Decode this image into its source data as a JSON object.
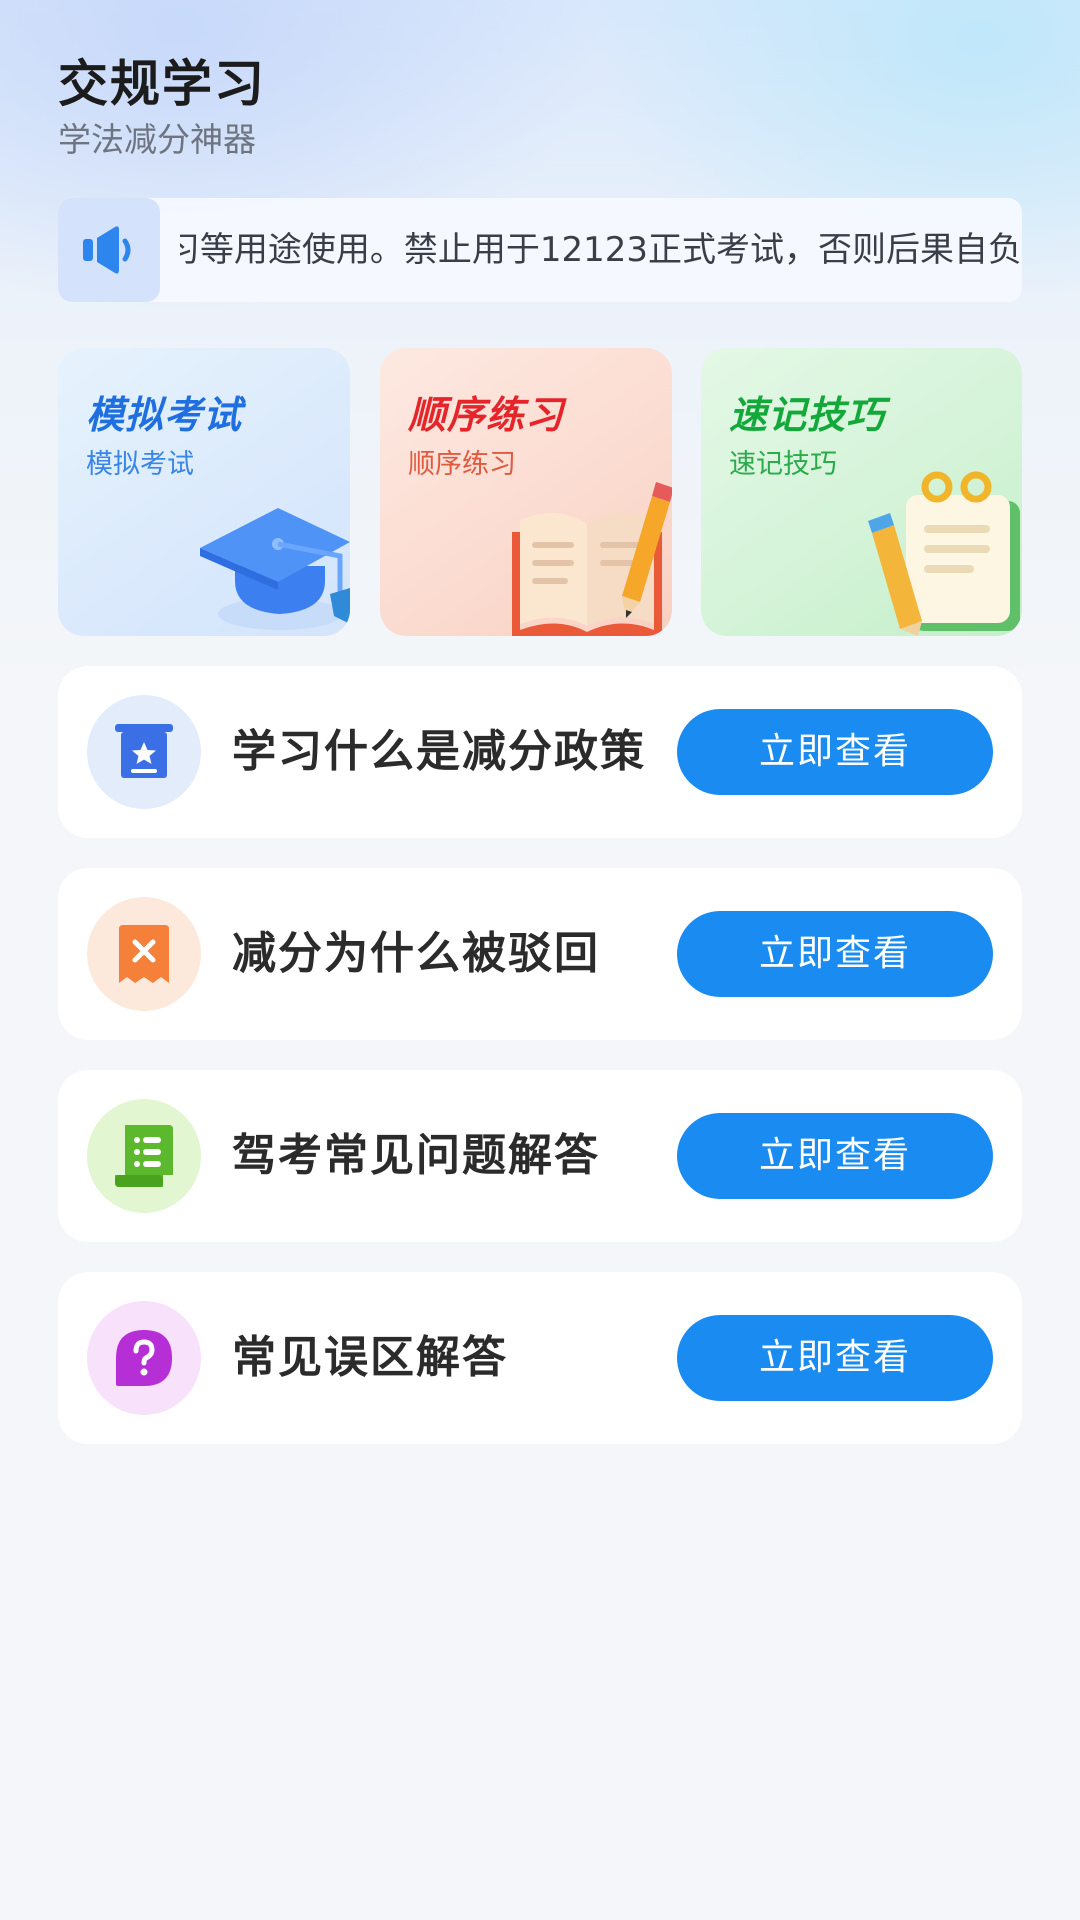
{
  "header": {
    "title": "交规学习",
    "subtitle": "学法减分神器"
  },
  "notice": {
    "icon": "speaker-icon",
    "text": "习等用途使用。禁止用于12123正式考试，否则后果自负"
  },
  "cards": [
    {
      "title": "模拟考试",
      "subtitle": "模拟考试",
      "icon": "graduation-cap-icon",
      "title_color": "#1f6fe0",
      "subtitle_color": "#3a86e8"
    },
    {
      "title": "顺序练习",
      "subtitle": "顺序练习",
      "icon": "book-pencil-icon",
      "title_color": "#e5252a",
      "subtitle_color": "#e05a40"
    },
    {
      "title": "速记技巧",
      "subtitle": "速记技巧",
      "icon": "notepad-pencil-icon",
      "title_color": "#13a93a",
      "subtitle_color": "#2bab4c"
    }
  ],
  "list": [
    {
      "title": "学习什么是减分政策",
      "button": "立即查看",
      "icon": "star-scroll-icon",
      "icon_color": "#3b6fe6",
      "bg_color": "#e3ecfb"
    },
    {
      "title": "减分为什么被驳回",
      "button": "立即查看",
      "icon": "rejected-receipt-icon",
      "icon_color": "#f5803a",
      "bg_color": "#fde9dc"
    },
    {
      "title": "驾考常见问题解答",
      "button": "立即查看",
      "icon": "document-list-icon",
      "icon_color": "#5cb82c",
      "bg_color": "#e2f6d2"
    },
    {
      "title": "常见误区解答",
      "button": "立即查看",
      "icon": "question-bubble-icon",
      "icon_color": "#b62fd6",
      "bg_color": "#f8e1fb"
    }
  ],
  "colors": {
    "primary_button": "#1a8cf1"
  }
}
